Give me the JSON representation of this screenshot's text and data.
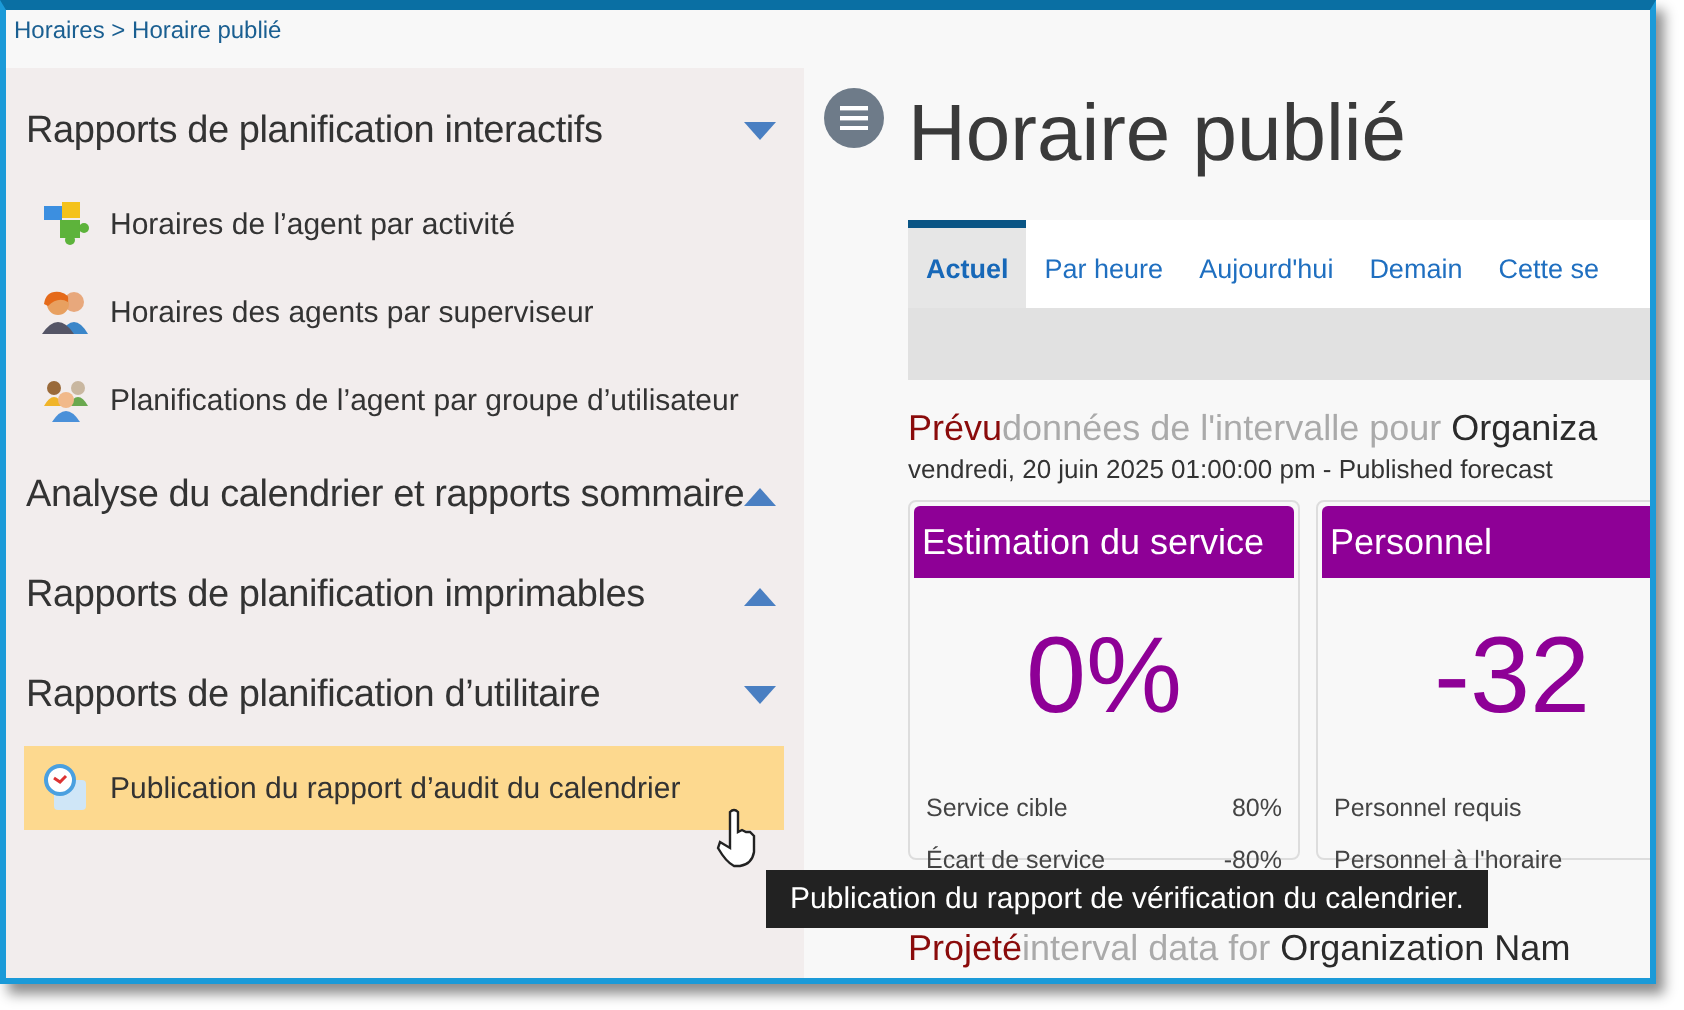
{
  "breadcrumb": "Horaires > Horaire publié",
  "sidebar": {
    "sections": [
      {
        "title": "Rapports de planification interactifs",
        "expanded": true,
        "items": [
          {
            "label": "Horaires de l’agent par activité",
            "kind": "puzzle",
            "selected": false
          },
          {
            "label": "Horaires des agents par superviseur",
            "kind": "people",
            "selected": false
          },
          {
            "label": "Planifications de l’agent par groupe d’utilisateur",
            "kind": "group",
            "selected": false
          }
        ]
      },
      {
        "title": "Analyse du calendrier et rapports sommaire",
        "expanded": false
      },
      {
        "title": "Rapports de planification imprimables",
        "expanded": false
      },
      {
        "title": "Rapports de planification d’utilitaire",
        "expanded": true,
        "items": [
          {
            "label": "Publication du rapport d’audit du calendrier",
            "kind": "clock",
            "selected": true
          }
        ]
      }
    ]
  },
  "page_title": "Horaire publié",
  "tabs": [
    {
      "label": "Actuel",
      "selected": true
    },
    {
      "label": "Par heure",
      "selected": false
    },
    {
      "label": "Aujourd'hui",
      "selected": false
    },
    {
      "label": "Demain",
      "selected": false
    },
    {
      "label": "Cette se",
      "selected": false
    }
  ],
  "interval_heading": {
    "parts": [
      {
        "text": "Prévu",
        "kind": "forecast"
      },
      {
        "text": "données de l'intervalle pour",
        "kind": "muted"
      },
      {
        "text": "Organiza",
        "kind": "org"
      }
    ],
    "subtitle": "vendredi, 20 juin 2025 01:00:00 pm - Published forecast"
  },
  "cards": [
    {
      "title": "Estimation du service",
      "value": "0%",
      "rows": [
        {
          "label": "Service cible",
          "value": "80%"
        },
        {
          "label": "Écart de service",
          "value": "-80%"
        }
      ]
    },
    {
      "title": "Personnel",
      "value": "-32",
      "rows": [
        {
          "label": "Personnel requis"
        },
        {
          "label": "Personnel à l'horaire"
        }
      ]
    }
  ],
  "projected_heading": {
    "parts": [
      {
        "text": "Projeté",
        "kind": "forecast"
      },
      {
        "text": "interval data for",
        "kind": "muted"
      },
      {
        "text": "Organization Nam",
        "kind": "org"
      }
    ]
  },
  "tooltip": "Publication du rapport de vérification du calendrier."
}
